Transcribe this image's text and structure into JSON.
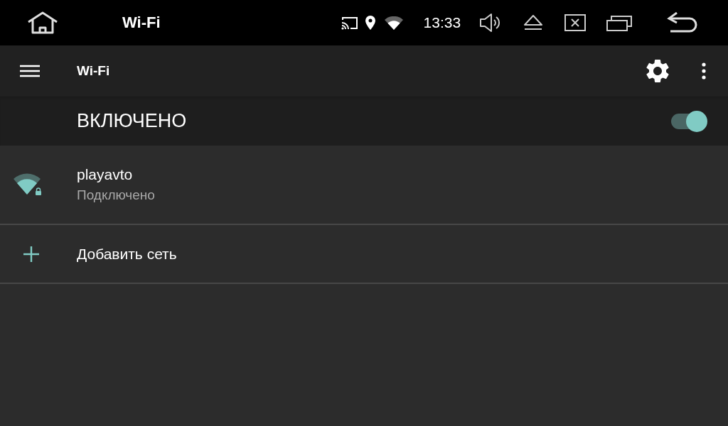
{
  "status_bar": {
    "title": "Wi-Fi",
    "time": "13:33"
  },
  "toolbar": {
    "title": "Wi-Fi"
  },
  "master_switch": {
    "label": "ВКЛЮЧЕНО",
    "on": true
  },
  "networks": [
    {
      "name": "playavto",
      "status": "Подключено",
      "secured": true
    }
  ],
  "add_network": {
    "label": "Добавить сеть"
  }
}
